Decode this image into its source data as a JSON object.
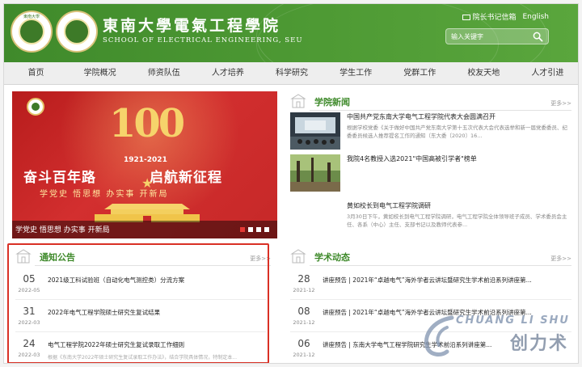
{
  "header": {
    "school_cn": "東南大學電氣工程學院",
    "school_en": "SCHOOL OF ELECTRICAL ENGINEERING, SEU",
    "seal_text": "東南大學",
    "mail_link": "院长书记信箱",
    "lang_link": "English",
    "search_placeholder": "输入关键字",
    "colors": {
      "brand_green": "#4e9a34",
      "accent_red": "#d32f2f"
    }
  },
  "nav": {
    "items": [
      "首页",
      "学院概况",
      "师资队伍",
      "人才培养",
      "科学研究",
      "学生工作",
      "党群工作",
      "校友天地",
      "人才引进"
    ]
  },
  "banner": {
    "hundred": "100",
    "years": "1921-2021",
    "headline_left": "奋斗百年路",
    "headline_right": "启航新征程",
    "sub": "学党史  悟思想  办实事  开新局",
    "caption": "学党史 悟思想 办实事 开新局",
    "slides": 4,
    "active_slide": 1
  },
  "news": {
    "title": "学院新闻",
    "more": "更多>>",
    "items": [
      {
        "title": "中国共产党东南大学电气工程学院代表大会圆满召开",
        "desc": "根据学校党委《关于做好中国共产党东南大学第十五次代表大会代表选举和新一届党委委员、纪委委员候选人推荐提名工作的通知（东大委〔2020〕16..."
      },
      {
        "title": "我院4名教授入选2021\"中国高被引学者\"榜单",
        "desc": ""
      },
      {
        "title": "黄如校长到电气工程学院调研",
        "desc": "3月30日下午，黄如校长到电气工程学院调研，电气工程学院全体领导班子成员、学术委员会主任、各系（中心）主任、支部书记以及教师代表参..."
      }
    ]
  },
  "notices": {
    "title": "通知公告",
    "more": "更多>>",
    "items": [
      {
        "day": "05",
        "ym": "2022-05",
        "title": "2021级工科试验班（自动化电气测控类）分流方案",
        "sub": ""
      },
      {
        "day": "31",
        "ym": "2022-03",
        "title": "2022年电气工程学院硕士研究生复试结果",
        "sub": ""
      },
      {
        "day": "24",
        "ym": "2022-03",
        "title": "电气工程学院2022年硕士研究生复试录取工作细则",
        "sub": "根据《东南大学2022年硕士研究生复试录取工作办法》，结合学院具体情况，特制定本..."
      }
    ]
  },
  "academic": {
    "title": "学术动态",
    "more": "更多>>",
    "items": [
      {
        "day": "28",
        "ym": "2021-12",
        "title": "讲座预告 | 2021年“卓越电气”海外学者云讲坛暨研究生学术前沿系列讲座第..."
      },
      {
        "day": "08",
        "ym": "2021-12",
        "title": "讲座预告 | 2021年“卓越电气”海外学者云讲坛暨研究生学术前沿系列讲座第..."
      },
      {
        "day": "06",
        "ym": "2021-12",
        "title": "讲座预告 | 东南大学电气工程学院研究生学术前沿系列讲座第..."
      }
    ]
  },
  "watermark": {
    "en": "CHUANG LI SHU",
    "cn": "创力术"
  }
}
